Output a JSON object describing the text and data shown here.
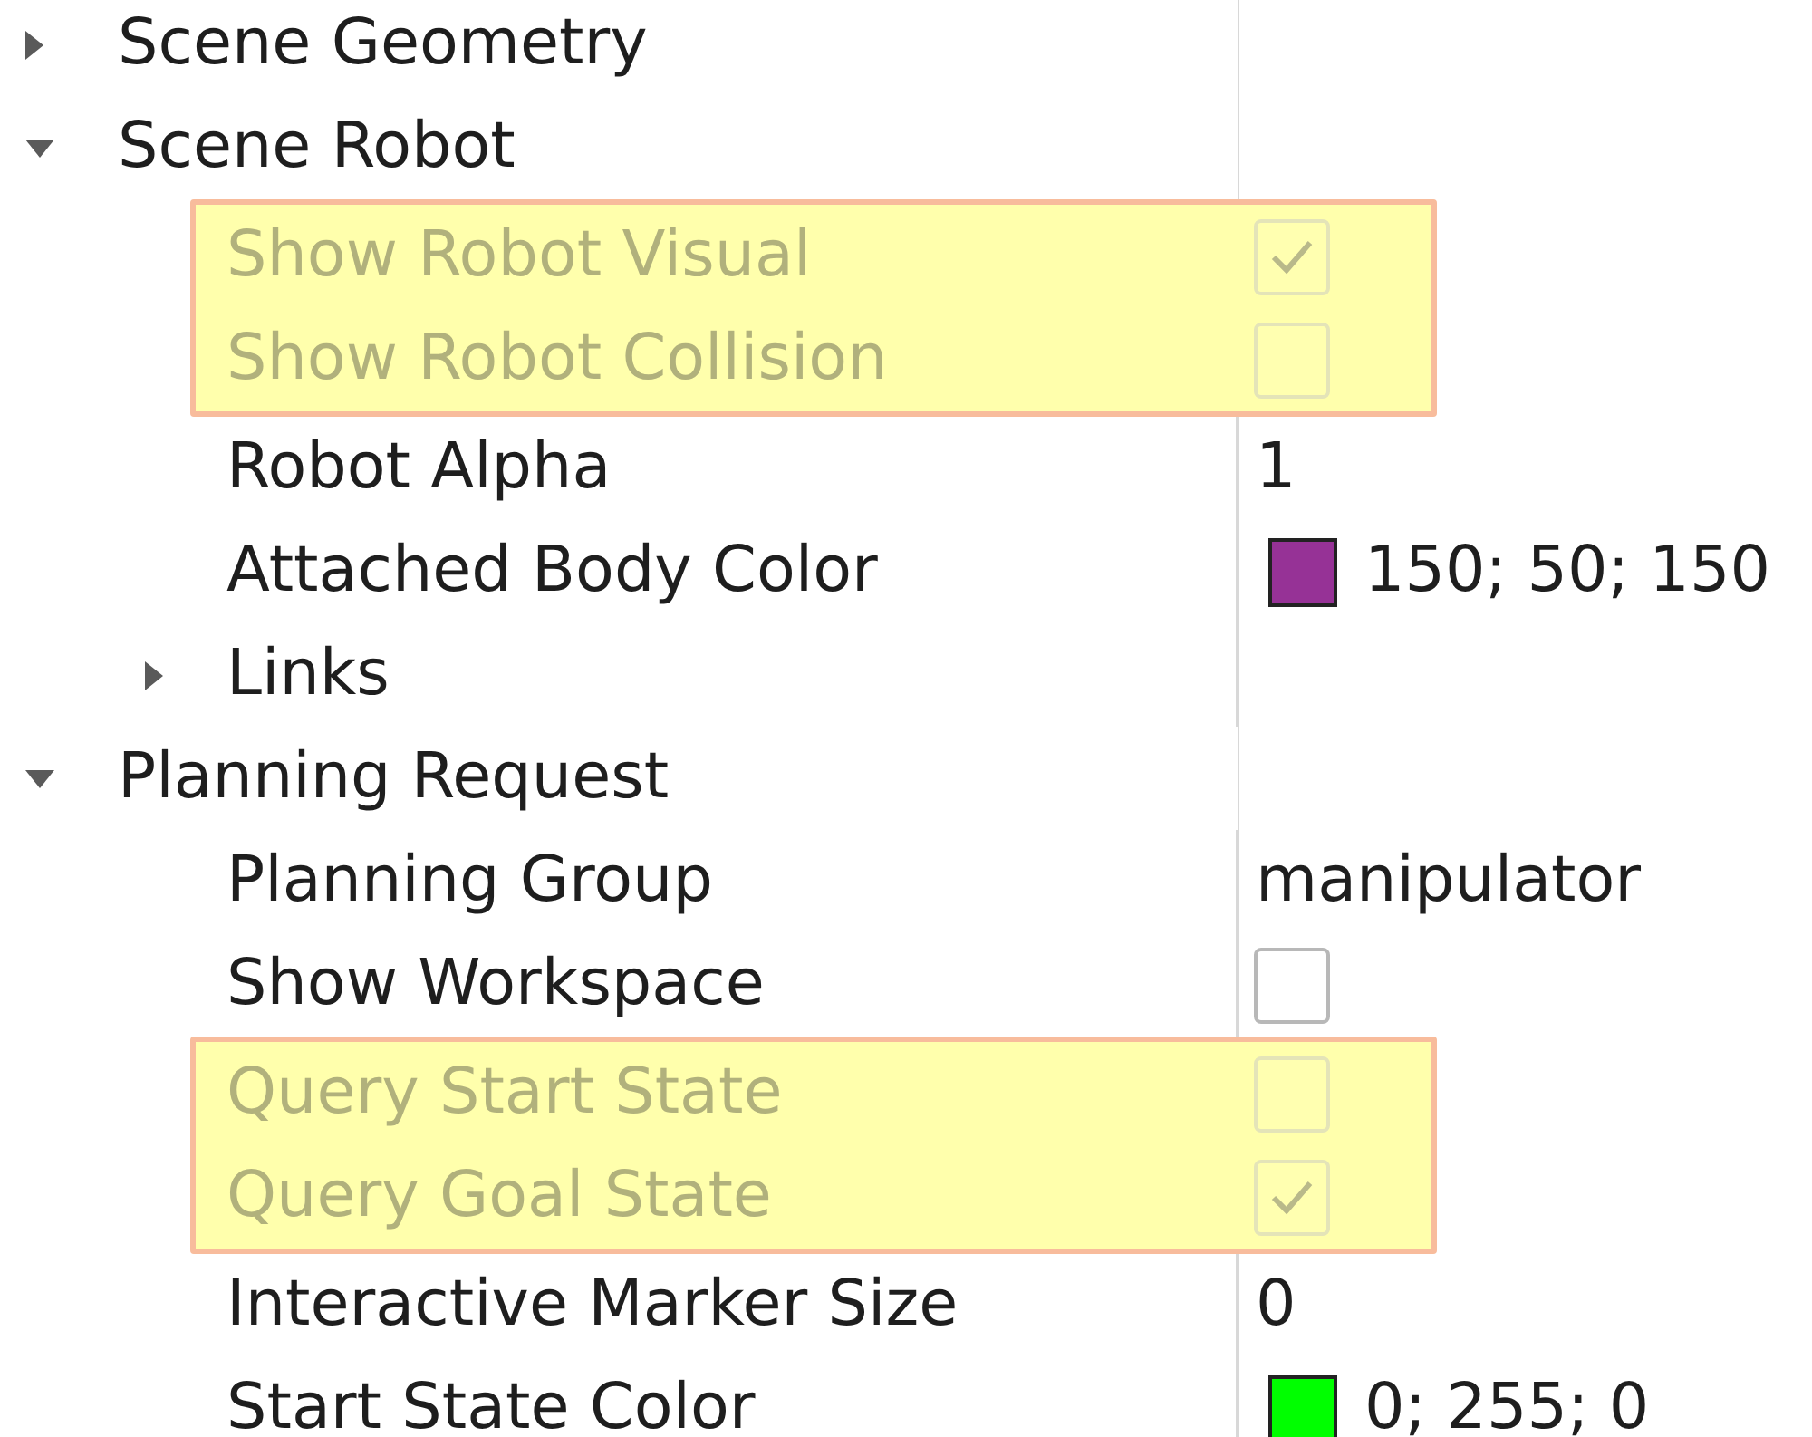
{
  "tree": [
    {
      "kind": "group",
      "label": "Scene Geometry",
      "expanded": false
    },
    {
      "kind": "group",
      "label": "Scene Robot",
      "expanded": true,
      "children": [
        {
          "kind": "checkbox",
          "label": "Show Robot Visual",
          "checked": true,
          "disabled": true,
          "highlighted": true
        },
        {
          "kind": "checkbox",
          "label": "Show Robot Collision",
          "checked": false,
          "disabled": true,
          "highlighted": true
        },
        {
          "kind": "text",
          "label": "Robot Alpha",
          "value": "1",
          "highlighted": false
        },
        {
          "kind": "color",
          "label": "Attached Body Color",
          "color": "#963296",
          "value": "150; 50; 150",
          "highlighted": false
        },
        {
          "kind": "group",
          "label": "Links",
          "expanded": false,
          "highlighted": false
        }
      ]
    },
    {
      "kind": "group",
      "label": "Planning Request",
      "expanded": true,
      "children": [
        {
          "kind": "text",
          "label": "Planning Group",
          "value": "manipulator",
          "highlighted": false
        },
        {
          "kind": "checkbox",
          "label": "Show Workspace",
          "checked": false,
          "disabled": false,
          "highlighted": false
        },
        {
          "kind": "checkbox",
          "label": "Query Start State",
          "checked": false,
          "disabled": true,
          "highlighted": true
        },
        {
          "kind": "checkbox",
          "label": "Query Goal State",
          "checked": true,
          "disabled": true,
          "highlighted": true
        },
        {
          "kind": "text",
          "label": "Interactive Marker Size",
          "value": "0",
          "highlighted": false
        },
        {
          "kind": "color",
          "label": "Start State Color",
          "color": "#00ff00",
          "value": "0; 255; 0",
          "highlighted": false
        }
      ]
    }
  ]
}
